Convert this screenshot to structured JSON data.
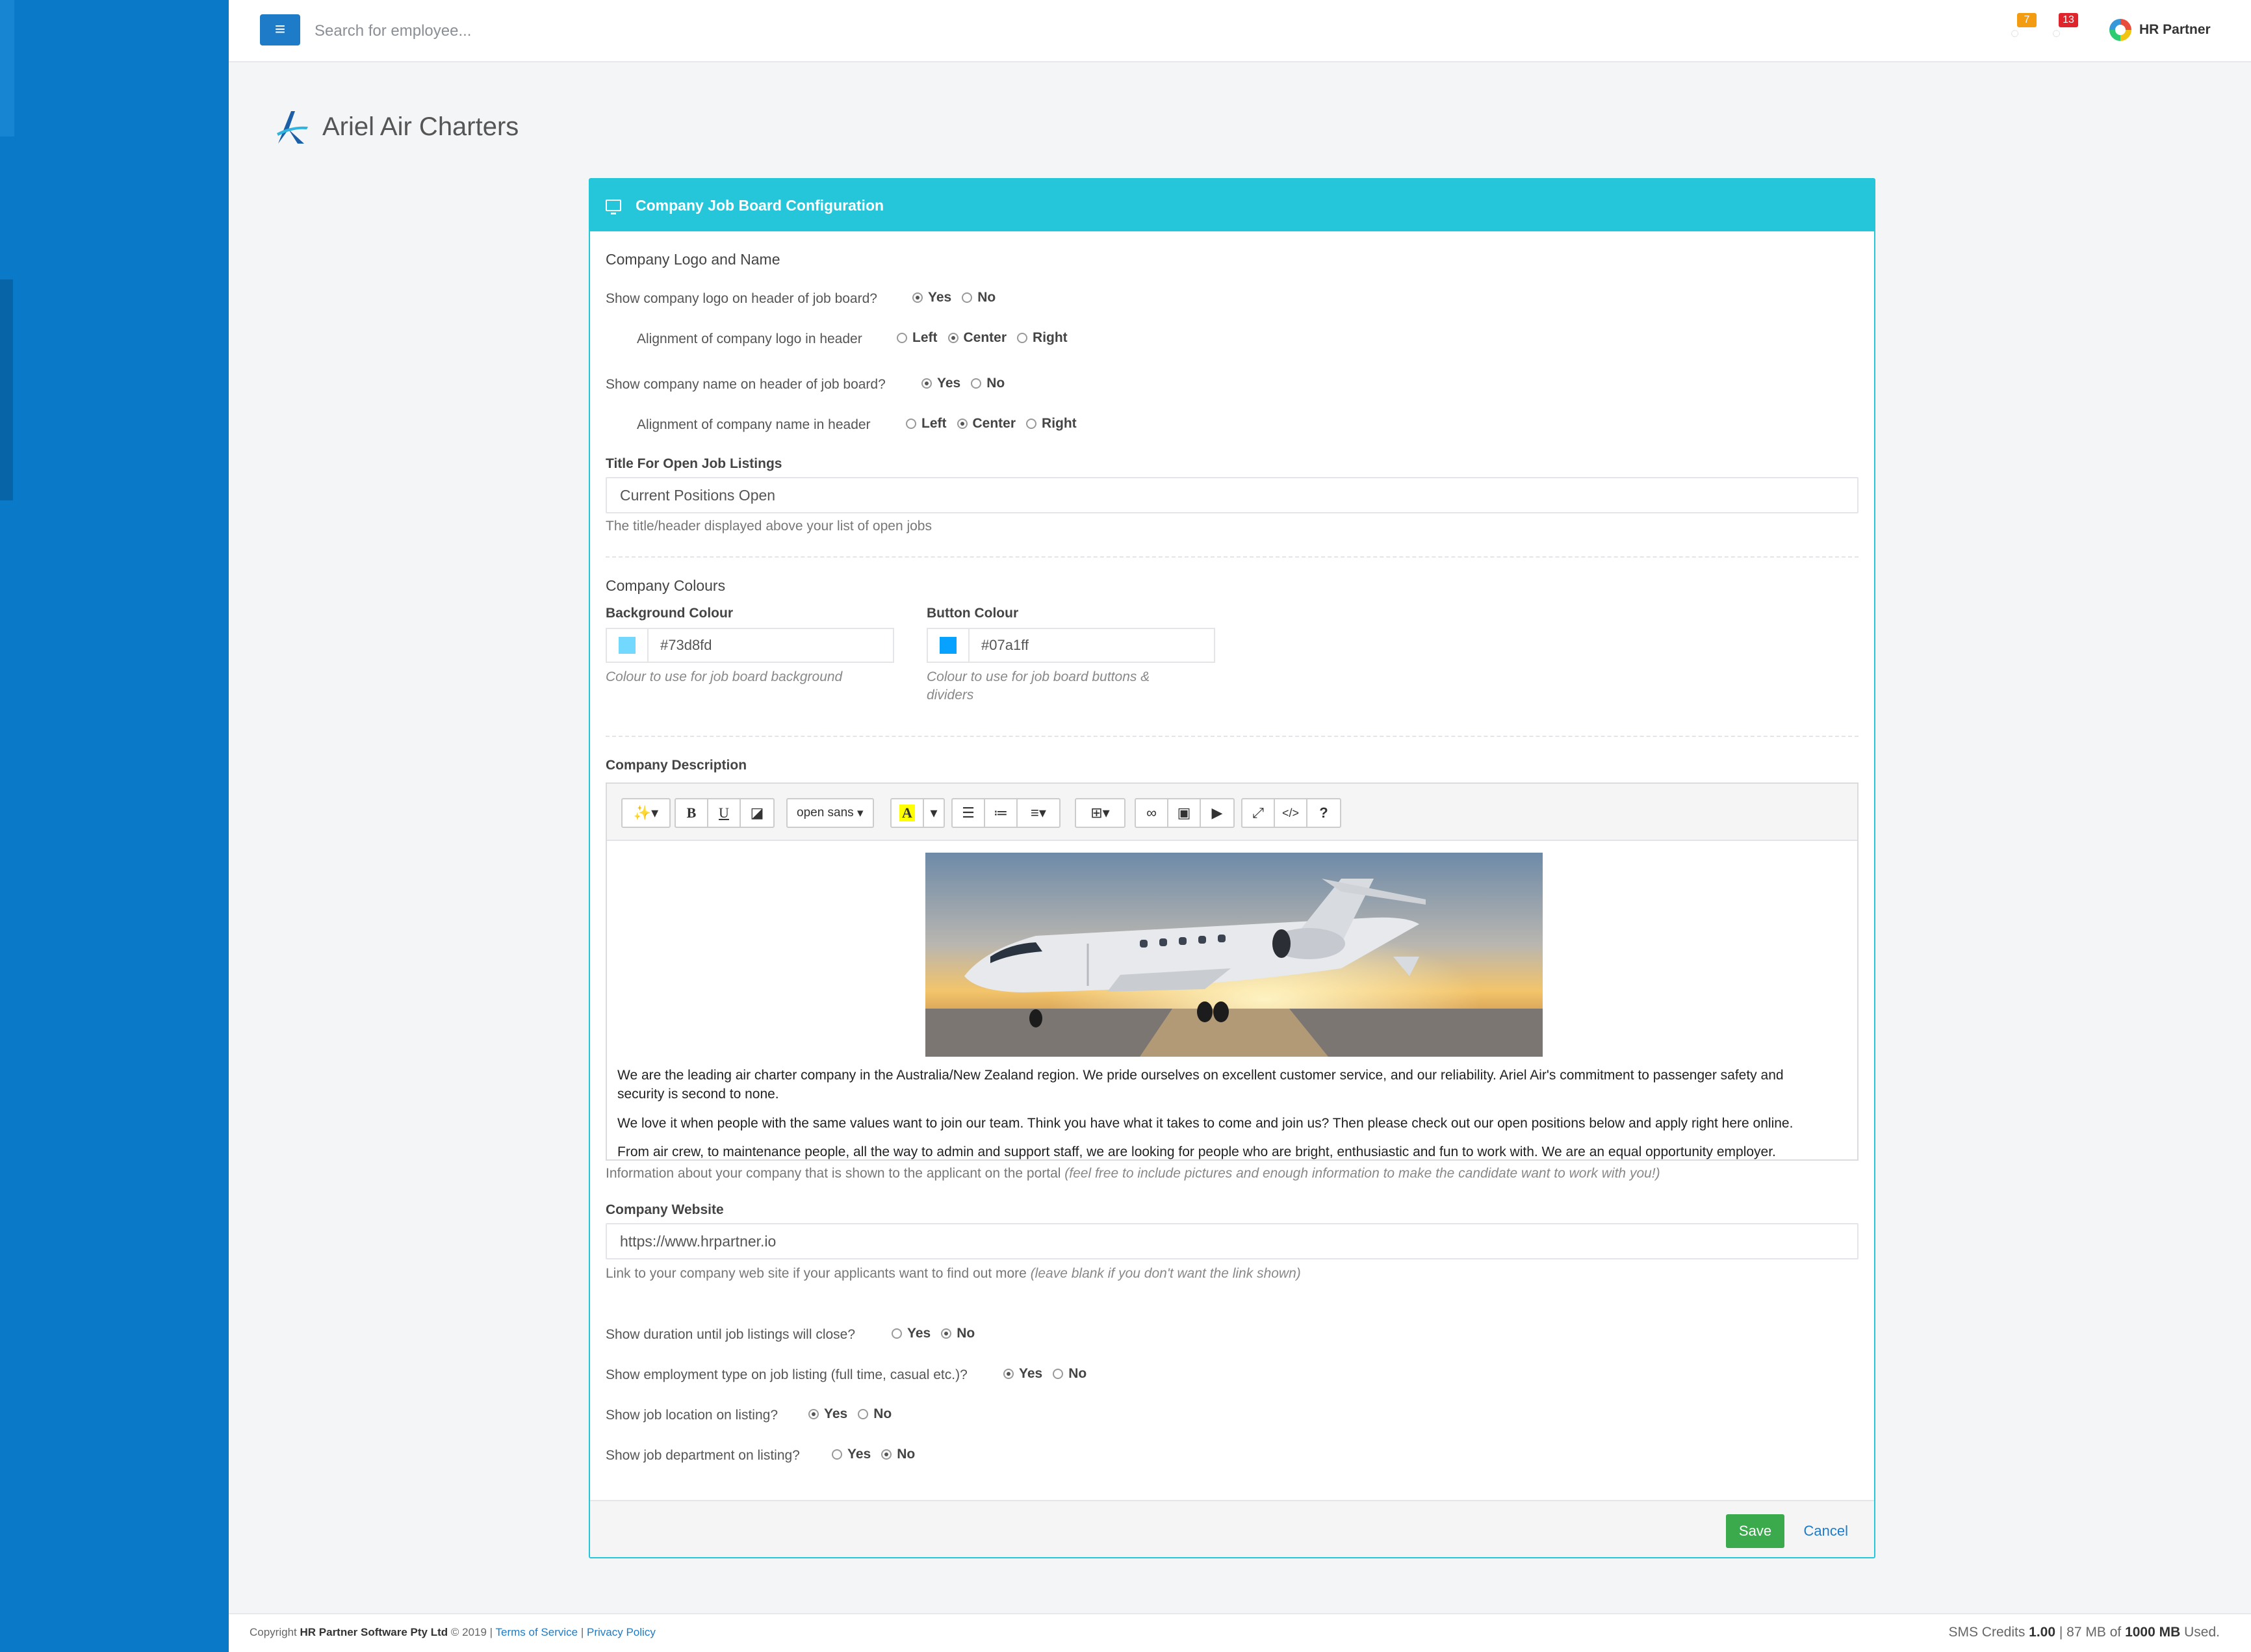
{
  "topbar": {
    "search_placeholder": "Search for employee...",
    "notifications": [
      {
        "icon": "bell-icon",
        "count": "7",
        "color": "#f39c12"
      },
      {
        "icon": "bell-icon",
        "count": "13",
        "color": "#e0242c"
      }
    ],
    "user_name": "HR Partner"
  },
  "company": {
    "name": "Ariel Air Charters"
  },
  "panel": {
    "title": "Company Job Board Configuration",
    "logo_section": {
      "title": "Company Logo and Name",
      "show_logo_q": "Show company logo on header of job board?",
      "show_logo_options": [
        "Yes",
        "No"
      ],
      "show_logo_selected": "Yes",
      "logo_align_q": "Alignment of company logo in header",
      "logo_align_options": [
        "Left",
        "Center",
        "Right"
      ],
      "logo_align_selected": "Center",
      "show_name_q": "Show company name on header of job board?",
      "show_name_options": [
        "Yes",
        "No"
      ],
      "show_name_selected": "Yes",
      "name_align_q": "Alignment of company name in header",
      "name_align_options": [
        "Left",
        "Center",
        "Right"
      ],
      "name_align_selected": "Center"
    },
    "listings_title": {
      "label": "Title For Open Job Listings",
      "value": "Current Positions Open",
      "help": "The title/header displayed above your list of open jobs"
    },
    "colours": {
      "title": "Company Colours",
      "background_label": "Background Colour",
      "background_value": "#73d8fd",
      "background_help": "Colour to use for job board background",
      "button_label": "Button Colour",
      "button_value": "#07a1ff",
      "button_help_line1": "Colour to use for job board buttons &",
      "button_help_line2": "dividers"
    },
    "description": {
      "label": "Company Description",
      "font_name": "open sans",
      "paragraphs": [
        "We are the leading air charter company in the Australia/New Zealand region.  We pride ourselves on excellent customer service, and our reliability.  Ariel Air's commitment to passenger safety and",
        "security is second to none.",
        "We love it when people with the same values want to join our team.  Think you have what it takes to come and join us? Then please check out our open positions below and apply right here online.",
        "From air crew, to maintenance people, all the way to admin and support staff, we are looking for people who are bright, enthusiastic and fun to work with.  We are an equal opportunity employer."
      ],
      "help": "Information about your company that is shown to the applicant on the portal",
      "help_italic": "(feel free to include pictures and enough information to make the candidate want to work with you!)"
    },
    "website": {
      "label": "Company Website",
      "value": "https://www.hrpartner.io",
      "help": "Link to your company web site if your applicants want to find out more",
      "help_italic": "(leave blank if you don't want the link shown)"
    },
    "options": {
      "duration_q": "Show duration until job listings will close?",
      "duration_selected": "No",
      "emptype_q": "Show employment type on job listing (full time, casual etc.)?",
      "emptype_selected": "Yes",
      "location_q": "Show job location on listing?",
      "location_selected": "Yes",
      "department_q": "Show job department on listing?",
      "department_selected": "No",
      "yes": "Yes",
      "no": "No"
    },
    "save_label": "Save",
    "cancel_label": "Cancel"
  },
  "footer": {
    "copyright_prefix": "Copyright",
    "company": "HR Partner Software Pty Ltd",
    "year": "© 2019 |",
    "terms": "Terms of Service",
    "sep": "|",
    "privacy": "Privacy Policy",
    "sms_label": "SMS Credits",
    "sms_value": "1.00",
    "storage_used": "| 87 MB of",
    "storage_total": "1000 MB",
    "storage_suffix": "Used."
  },
  "colors": {
    "sidebar": "#0a7ac8",
    "panel_accent": "#26c6da",
    "save_green": "#3aaa4c",
    "link_blue": "#1d7bc7"
  }
}
